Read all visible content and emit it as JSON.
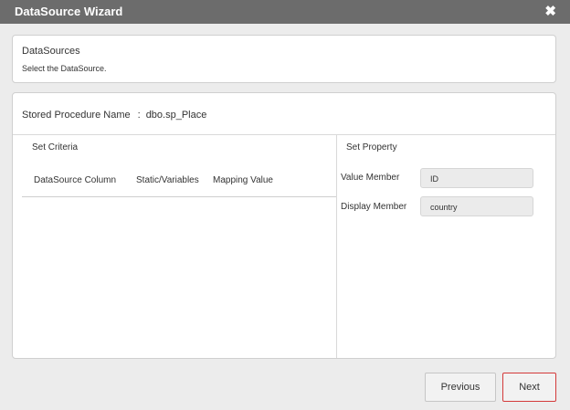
{
  "window": {
    "title": "DataSource Wizard",
    "close_glyph": "✖",
    "close_icon": "close-icon"
  },
  "datasources": {
    "heading": "DataSources",
    "subtitle": "Select the DataSource."
  },
  "stored_procedure": {
    "label": "Stored Procedure Name",
    "separator": ":",
    "value": "dbo.sp_Place"
  },
  "set_criteria": {
    "title": "Set Criteria",
    "columns": [
      "DataSource Column",
      "Static/Variables",
      "Mapping Value"
    ],
    "rows": []
  },
  "set_property": {
    "title": "Set Property",
    "value_member": {
      "label": "Value Member",
      "value": "ID"
    },
    "display_member": {
      "label": "Display Member",
      "value": "country"
    }
  },
  "buttons": {
    "previous": "Previous",
    "next": "Next"
  },
  "colors": {
    "titlebar": "#6c6c6c",
    "next_border": "#d43a3a"
  }
}
